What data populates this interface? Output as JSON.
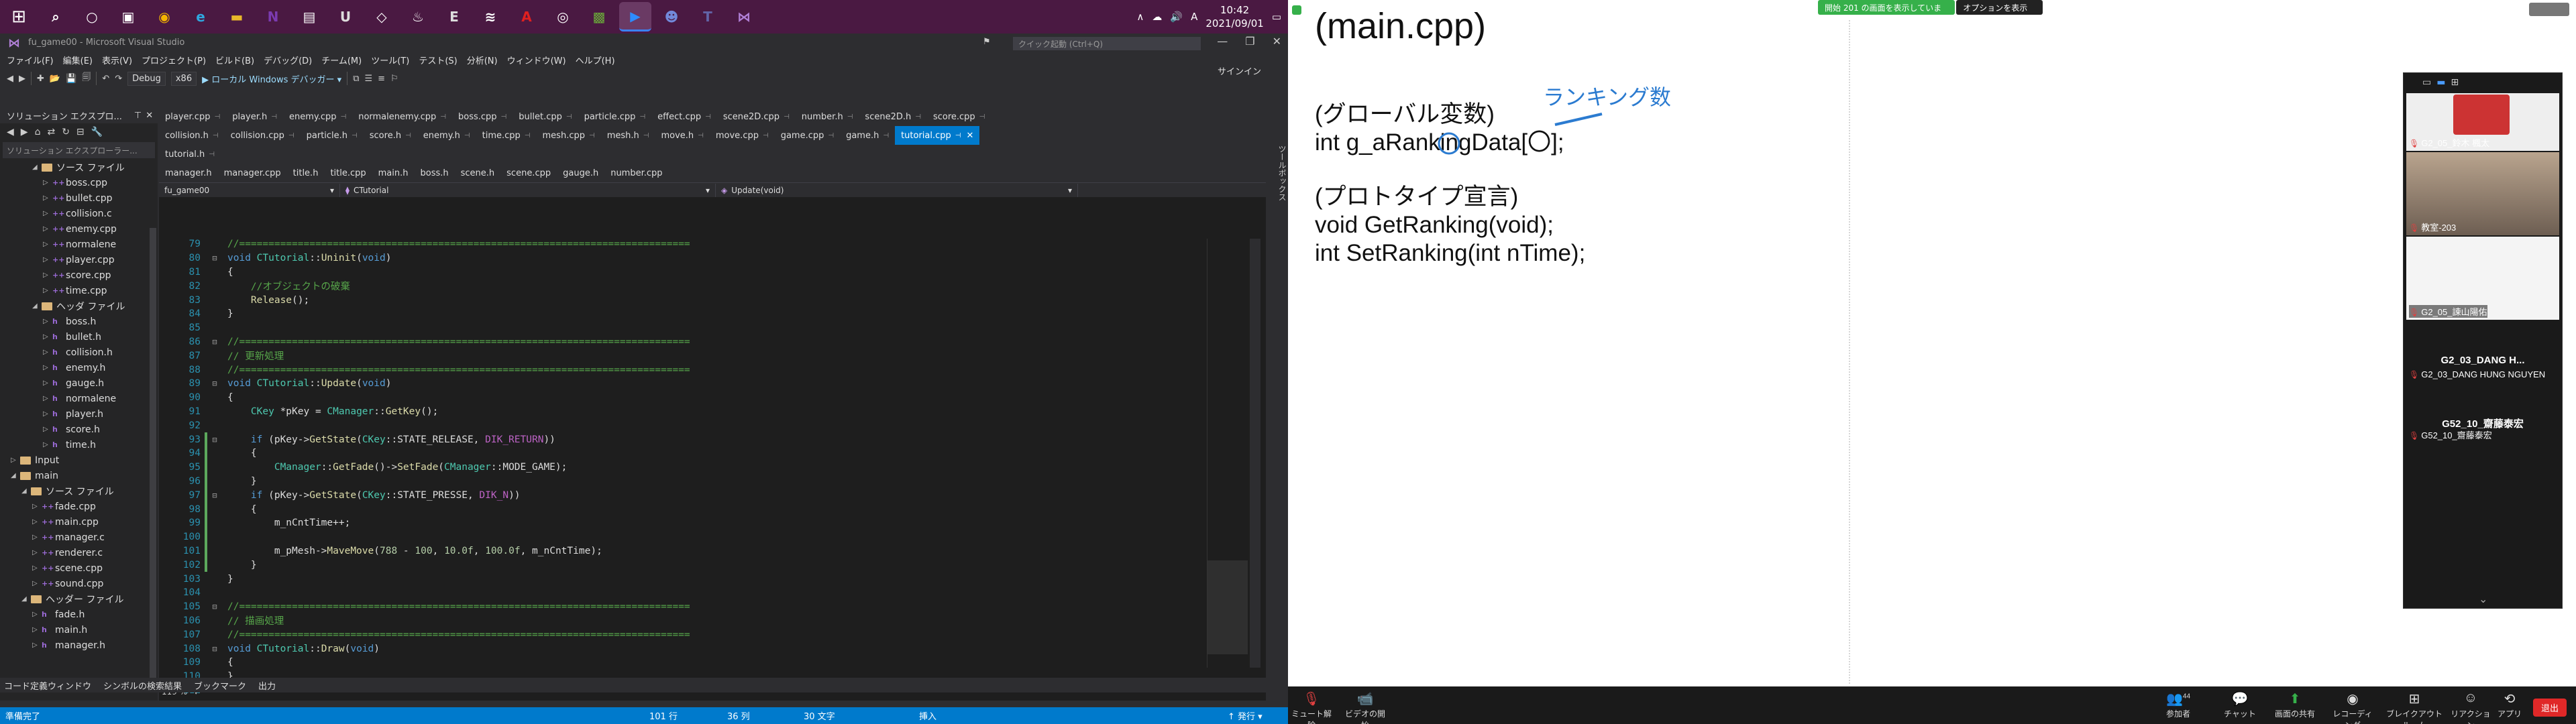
{
  "taskbar": {
    "icons": [
      "search-icon",
      "cortana-icon",
      "taskview-icon",
      "chrome-icon",
      "edge-icon",
      "explorer-icon",
      "onenote-icon",
      "photos-icon",
      "unreal-icon",
      "unity-icon",
      "steam-icon",
      "epic-icon",
      "vs-code-icon",
      "acrobat-icon",
      "obs-icon",
      "minecraft-icon",
      "zoom-icon",
      "discord-icon",
      "teams-icon",
      "vs-icon"
    ],
    "time": "10:42",
    "date": "2021/09/01",
    "ime": "A"
  },
  "vs": {
    "title": "fu_game00 - Microsoft Visual Studio",
    "quick_launch": "クイック起動 (Ctrl+Q)",
    "menu": [
      "ファイル(F)",
      "編集(E)",
      "表示(V)",
      "プロジェクト(P)",
      "ビルド(B)",
      "デバッグ(D)",
      "チーム(M)",
      "ツール(T)",
      "テスト(S)",
      "分析(N)",
      "ウィンドウ(W)",
      "ヘルプ(H)"
    ],
    "signin": "サインイン",
    "toolbar": {
      "config": "Debug",
      "platform": "x86",
      "run": "ローカル Windows デバッガー"
    },
    "solution": {
      "title": "ソリューション エクスプロ...",
      "search": "ソリューション エクスプローラー...",
      "items": [
        {
          "label": "ソース ファイル",
          "kind": "folder",
          "indent": 3,
          "tri": "◢"
        },
        {
          "label": "boss.cpp",
          "kind": "cpp",
          "indent": 4,
          "tri": "▷"
        },
        {
          "label": "bullet.cpp",
          "kind": "cpp",
          "indent": 4,
          "tri": "▷"
        },
        {
          "label": "collision.c",
          "kind": "cpp",
          "indent": 4,
          "tri": "▷"
        },
        {
          "label": "enemy.cpp",
          "kind": "cpp",
          "indent": 4,
          "tri": "▷"
        },
        {
          "label": "normalene",
          "kind": "cpp",
          "indent": 4,
          "tri": "▷"
        },
        {
          "label": "player.cpp",
          "kind": "cpp",
          "indent": 4,
          "tri": "▷"
        },
        {
          "label": "score.cpp",
          "kind": "cpp",
          "indent": 4,
          "tri": "▷"
        },
        {
          "label": "time.cpp",
          "kind": "cpp",
          "indent": 4,
          "tri": "▷"
        },
        {
          "label": "ヘッダ ファイル",
          "kind": "folder",
          "indent": 3,
          "tri": "◢"
        },
        {
          "label": "boss.h",
          "kind": "h",
          "indent": 4,
          "tri": "▷"
        },
        {
          "label": "bullet.h",
          "kind": "h",
          "indent": 4,
          "tri": "▷"
        },
        {
          "label": "collision.h",
          "kind": "h",
          "indent": 4,
          "tri": "▷"
        },
        {
          "label": "enemy.h",
          "kind": "h",
          "indent": 4,
          "tri": "▷"
        },
        {
          "label": "gauge.h",
          "kind": "h",
          "indent": 4,
          "tri": "▷"
        },
        {
          "label": "normalene",
          "kind": "h",
          "indent": 4,
          "tri": "▷"
        },
        {
          "label": "player.h",
          "kind": "h",
          "indent": 4,
          "tri": "▷"
        },
        {
          "label": "score.h",
          "kind": "h",
          "indent": 4,
          "tri": "▷"
        },
        {
          "label": "time.h",
          "kind": "h",
          "indent": 4,
          "tri": "▷"
        },
        {
          "label": "Input",
          "kind": "folder",
          "indent": 1,
          "tri": "▷"
        },
        {
          "label": "main",
          "kind": "folder",
          "indent": 1,
          "tri": "◢"
        },
        {
          "label": "ソース ファイル",
          "kind": "folder",
          "indent": 2,
          "tri": "◢"
        },
        {
          "label": "fade.cpp",
          "kind": "cpp",
          "indent": 3,
          "tri": "▷"
        },
        {
          "label": "main.cpp",
          "kind": "cpp",
          "indent": 3,
          "tri": "▷"
        },
        {
          "label": "manager.c",
          "kind": "cpp",
          "indent": 3,
          "tri": "▷"
        },
        {
          "label": "renderer.c",
          "kind": "cpp",
          "indent": 3,
          "tri": "▷"
        },
        {
          "label": "scene.cpp",
          "kind": "cpp",
          "indent": 3,
          "tri": "▷"
        },
        {
          "label": "sound.cpp",
          "kind": "cpp",
          "indent": 3,
          "tri": "▷"
        },
        {
          "label": "ヘッダー ファイル",
          "kind": "folder",
          "indent": 2,
          "tri": "◢"
        },
        {
          "label": "fade.h",
          "kind": "h",
          "indent": 3,
          "tri": "▷"
        },
        {
          "label": "main.h",
          "kind": "h",
          "indent": 3,
          "tri": "▷"
        },
        {
          "label": "manager.h",
          "kind": "h",
          "indent": 3,
          "tri": "▷"
        }
      ]
    },
    "tabs_row1": [
      "player.cpp",
      "player.h",
      "enemy.cpp",
      "normalenemy.cpp",
      "boss.cpp",
      "bullet.cpp",
      "particle.cpp",
      "effect.cpp",
      "scene2D.cpp",
      "number.h",
      "scene2D.h",
      "score.cpp"
    ],
    "tabs_row2": [
      "collision.h",
      "collision.cpp",
      "particle.h",
      "score.h",
      "enemy.h",
      "time.cpp",
      "mesh.cpp",
      "mesh.h",
      "move.h",
      "move.cpp",
      "game.cpp",
      "game.h"
    ],
    "tabs_active": "tutorial.cpp",
    "tabs_row3": [
      "tutorial.h"
    ],
    "tabs_row4": [
      "manager.h",
      "manager.cpp",
      "title.h",
      "title.cpp",
      "main.h",
      "boss.h",
      "scene.h",
      "scene.cpp",
      "gauge.h",
      "number.cpp"
    ],
    "nav": {
      "project": "fu_game00",
      "scope": "CTutorial",
      "member": "Update(void)"
    },
    "code": [
      {
        "n": "79",
        "fold": "",
        "chg": false,
        "html": "<span class=\"c-com\">//=============================================================================</span>"
      },
      {
        "n": "80",
        "fold": "⊟",
        "chg": false,
        "html": "<span class=\"c-kw\">void</span> <span class=\"c-cls\">CTutorial</span>::<span class=\"c-fn\">Uninit</span>(<span class=\"c-kw\">void</span>)"
      },
      {
        "n": "81",
        "fold": "",
        "chg": false,
        "html": "{"
      },
      {
        "n": "82",
        "fold": "",
        "chg": false,
        "html": "    <span class=\"c-com\">//オブジェクトの破棄</span>"
      },
      {
        "n": "83",
        "fold": "",
        "chg": false,
        "html": "    <span class=\"c-fn\">Release</span>();"
      },
      {
        "n": "84",
        "fold": "",
        "chg": false,
        "html": "}"
      },
      {
        "n": "85",
        "fold": "",
        "chg": false,
        "html": ""
      },
      {
        "n": "86",
        "fold": "⊟",
        "chg": false,
        "html": "<span class=\"c-com\">//=============================================================================</span>"
      },
      {
        "n": "87",
        "fold": "",
        "chg": false,
        "html": "<span class=\"c-com\">// 更新処理</span>"
      },
      {
        "n": "88",
        "fold": "",
        "chg": false,
        "html": "<span class=\"c-com\">//=============================================================================</span>"
      },
      {
        "n": "89",
        "fold": "⊟",
        "chg": false,
        "html": "<span class=\"c-kw\">void</span> <span class=\"c-cls\">CTutorial</span>::<span class=\"c-fn\">Update</span>(<span class=\"c-kw\">void</span>)"
      },
      {
        "n": "90",
        "fold": "",
        "chg": false,
        "html": "{"
      },
      {
        "n": "91",
        "fold": "",
        "chg": false,
        "html": "    <span class=\"c-cls\">CKey</span> *pKey = <span class=\"c-cls\">CManager</span>::<span class=\"c-fn\">GetKey</span>();"
      },
      {
        "n": "92",
        "fold": "",
        "chg": false,
        "html": ""
      },
      {
        "n": "93",
        "fold": "⊟",
        "chg": true,
        "html": "    <span class=\"c-kw\">if</span> (pKey-&gt;<span class=\"c-fn\">GetState</span>(<span class=\"c-cls\">CKey</span>::STATE_RELEASE, <span class=\"c-mac\">DIK_RETURN</span>))"
      },
      {
        "n": "94",
        "fold": "",
        "chg": true,
        "html": "    {"
      },
      {
        "n": "95",
        "fold": "",
        "chg": true,
        "html": "        <span class=\"c-cls\">CManager</span>::<span class=\"c-fn\">GetFade</span>()-&gt;<span class=\"c-fn\">SetFade</span>(<span class=\"c-cls\">CManager</span>::MODE_GAME);"
      },
      {
        "n": "96",
        "fold": "",
        "chg": true,
        "html": "    }"
      },
      {
        "n": "97",
        "fold": "⊟",
        "chg": true,
        "html": "    <span class=\"c-kw\">if</span> (pKey-&gt;<span class=\"c-fn\">GetState</span>(<span class=\"c-cls\">CKey</span>::STATE_PRESSE, <span class=\"c-mac\">DIK_N</span>))"
      },
      {
        "n": "98",
        "fold": "",
        "chg": true,
        "html": "    {"
      },
      {
        "n": "99",
        "fold": "",
        "chg": true,
        "html": "        m_nCntTime++;"
      },
      {
        "n": "100",
        "fold": "",
        "chg": true,
        "html": ""
      },
      {
        "n": "101",
        "fold": "",
        "chg": true,
        "html": "        m_pMesh-&gt;<span class=\"c-fn\">MaveMove</span>(<span class=\"c-num\">788</span> - <span class=\"c-num\">100</span>, <span class=\"c-num\">10.0f</span>, <span class=\"c-num\">100.0f</span>, m_nCntTime);"
      },
      {
        "n": "102",
        "fold": "",
        "chg": true,
        "html": "    }"
      },
      {
        "n": "103",
        "fold": "",
        "chg": false,
        "html": "}"
      },
      {
        "n": "104",
        "fold": "",
        "chg": false,
        "html": ""
      },
      {
        "n": "105",
        "fold": "⊟",
        "chg": false,
        "html": "<span class=\"c-com\">//=============================================================================</span>"
      },
      {
        "n": "106",
        "fold": "",
        "chg": false,
        "html": "<span class=\"c-com\">// 描画処理</span>"
      },
      {
        "n": "107",
        "fold": "",
        "chg": false,
        "html": "<span class=\"c-com\">//=============================================================================</span>"
      },
      {
        "n": "108",
        "fold": "⊟",
        "chg": false,
        "html": "<span class=\"c-kw\">void</span> <span class=\"c-cls\">CTutorial</span>::<span class=\"c-fn\">Draw</span>(<span class=\"c-kw\">void</span>)"
      },
      {
        "n": "109",
        "fold": "",
        "chg": false,
        "html": "{"
      },
      {
        "n": "110",
        "fold": "",
        "chg": false,
        "html": "}"
      },
      {
        "n": "111",
        "fold": "",
        "chg": false,
        "html": ""
      }
    ],
    "zoom": "119 %",
    "bottom_tabs": [
      "コード定義ウィンドウ",
      "シンボルの検索結果",
      "ブックマーク",
      "出力"
    ],
    "status": {
      "ready": "準備完了",
      "line": "101 行",
      "col": "36 列",
      "chars": "30 文字",
      "mode": "挿入",
      "publish": "↑ 発行 ▾"
    },
    "toolbox": "ツールボックス"
  },
  "zoom_app": {
    "top_green": "開始 201 の画面を表示しています",
    "top_options": "オプションを表示 ⌄",
    "doc": {
      "title": "(main.cpp)",
      "globals_head": "(グローバル変数)",
      "globals_line": "int g_aRankingData[〇];",
      "proto_head": "(プロトタイプ宣言)",
      "proto_line1": "void GetRanking(void);",
      "proto_line2": "int SetRanking(int nTime);"
    },
    "annotation": "ランキング数",
    "participants": [
      {
        "name": "G2_05_鈴木 楓太",
        "big": ""
      },
      {
        "name": "教室-203",
        "big": ""
      },
      {
        "name": "G2_05_諫山陽佑",
        "big": ""
      },
      {
        "name": "G2_03_DANG HUNG NGUYEN",
        "big": "G2_03_DANG H..."
      },
      {
        "name": "G52_10_齋藤泰宏",
        "big": "G52_10_齋藤泰宏"
      }
    ],
    "bottom": {
      "mute": "ミュート解除",
      "video": "ビデオの開始",
      "participants": "参加者",
      "participants_count": "44",
      "chat": "チャット",
      "share": "画面の共有",
      "record": "レコーディング",
      "breakout": "ブレイクアウトルーム",
      "reaction": "リアクション",
      "apps": "アプリ",
      "leave": "退出"
    }
  }
}
